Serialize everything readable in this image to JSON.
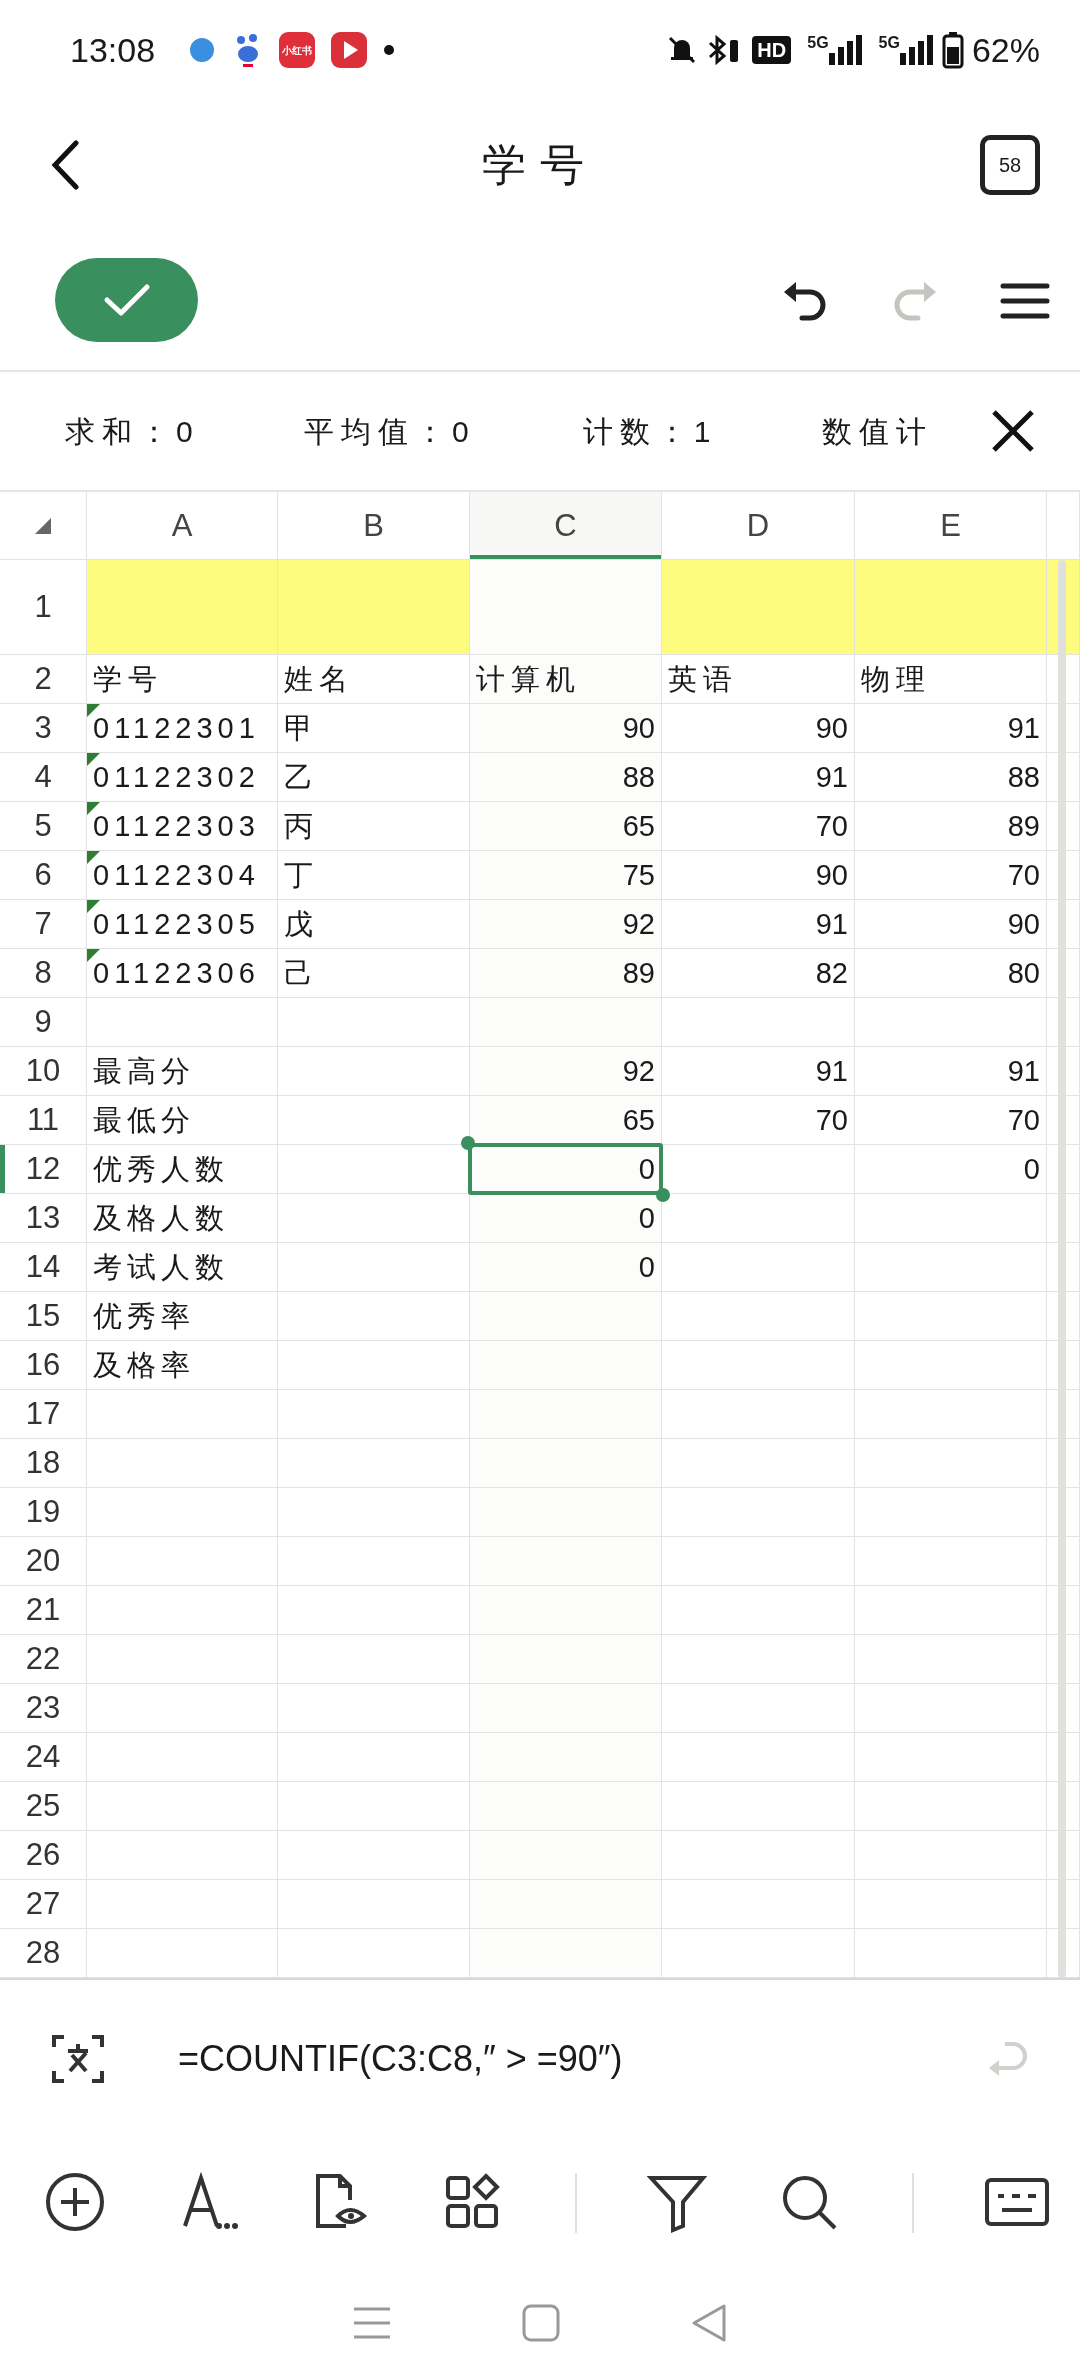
{
  "status_bar": {
    "time": "13:08",
    "app_icon_label": "小红书",
    "hd_label": "HD",
    "network_labels": [
      "5G",
      "5G"
    ],
    "battery": "62%"
  },
  "title_bar": {
    "title": "学号",
    "badge": "58"
  },
  "toolbar": {
    "buttons": [
      {
        "kind": "undo",
        "disabled": false
      },
      {
        "kind": "redo",
        "disabled": true
      },
      {
        "kind": "menu",
        "disabled": false
      }
    ]
  },
  "summary": [
    "求和：0",
    "平均值：0",
    "计数：1",
    "数值计"
  ],
  "columns": [
    {
      "label": "A",
      "selected": false
    },
    {
      "label": "B",
      "selected": false
    },
    {
      "label": "C",
      "selected": true
    },
    {
      "label": "D",
      "selected": false
    },
    {
      "label": "E",
      "selected": false
    }
  ],
  "rows": [
    {
      "header": "1",
      "selected": false,
      "flagged": false,
      "color": "#fdfc7e"
    },
    {
      "header": "2",
      "selected": false,
      "flagged": false,
      "kind": "labels",
      "cells": [
        "学号",
        "姓名",
        "计算机",
        "英语",
        "物理"
      ]
    },
    {
      "header": "3",
      "selected": false,
      "flagged": true,
      "kind": "data",
      "cells": [
        "01122301",
        "甲",
        "90",
        "90",
        "91"
      ]
    },
    {
      "header": "4",
      "selected": false,
      "flagged": true,
      "kind": "data",
      "cells": [
        "01122302",
        "乙",
        "88",
        "91",
        "88"
      ]
    },
    {
      "header": "5",
      "selected": false,
      "flagged": true,
      "kind": "data",
      "cells": [
        "01122303",
        "丙",
        "65",
        "70",
        "89"
      ]
    },
    {
      "header": "6",
      "selected": false,
      "flagged": true,
      "kind": "data",
      "cells": [
        "01122304",
        "丁",
        "75",
        "90",
        "70"
      ]
    },
    {
      "header": "7",
      "selected": false,
      "flagged": true,
      "kind": "data",
      "cells": [
        "01122305",
        "戊",
        "92",
        "91",
        "90"
      ]
    },
    {
      "header": "8",
      "selected": false,
      "flagged": true,
      "kind": "data",
      "cells": [
        "01122306",
        "己",
        "89",
        "82",
        "80"
      ]
    },
    {
      "header": "9",
      "selected": false,
      "flagged": false
    },
    {
      "header": "10",
      "selected": false,
      "flagged": false,
      "kind": "data",
      "cells": [
        "最高分",
        null,
        "92",
        "91",
        "91"
      ]
    },
    {
      "header": "11",
      "selected": false,
      "flagged": false,
      "kind": "data",
      "cells": [
        "最低分",
        null,
        "65",
        "70",
        "70"
      ]
    },
    {
      "header": "12",
      "selected": true,
      "flagged": false,
      "kind": "data",
      "cells": [
        "优秀人数",
        null,
        "0",
        null,
        "0"
      ]
    },
    {
      "header": "13",
      "selected": false,
      "flagged": false,
      "kind": "data",
      "cells": [
        "及格人数",
        null,
        "0"
      ]
    },
    {
      "header": "14",
      "selected": false,
      "flagged": false,
      "kind": "data",
      "cells": [
        "考试人数",
        null,
        "0"
      ]
    },
    {
      "header": "15",
      "selected": false,
      "flagged": false,
      "kind": "data",
      "cells": [
        "优秀率"
      ]
    },
    {
      "header": "16",
      "selected": false,
      "flagged": false,
      "kind": "data",
      "cells": [
        "及格率"
      ]
    },
    {
      "header": "17",
      "selected": false,
      "flagged": false
    },
    {
      "header": "18",
      "selected": false,
      "flagged": false
    },
    {
      "header": "19",
      "selected": false,
      "flagged": false
    },
    {
      "header": "20",
      "selected": false,
      "flagged": false
    },
    {
      "header": "21",
      "selected": false,
      "flagged": false
    },
    {
      "header": "22",
      "selected": false,
      "flagged": false
    },
    {
      "header": "23",
      "selected": false,
      "flagged": false
    },
    {
      "header": "24",
      "selected": false,
      "flagged": false
    },
    {
      "header": "25",
      "selected": false,
      "flagged": false
    },
    {
      "header": "26",
      "selected": false,
      "flagged": false
    },
    {
      "header": "27",
      "selected": false,
      "flagged": false
    },
    {
      "header": "28",
      "selected": false,
      "flagged": false
    }
  ],
  "formula_bar": {
    "formula": "=COUNTIF(C3:C8,″ > =90″)",
    "enter_disabled": true
  }
}
